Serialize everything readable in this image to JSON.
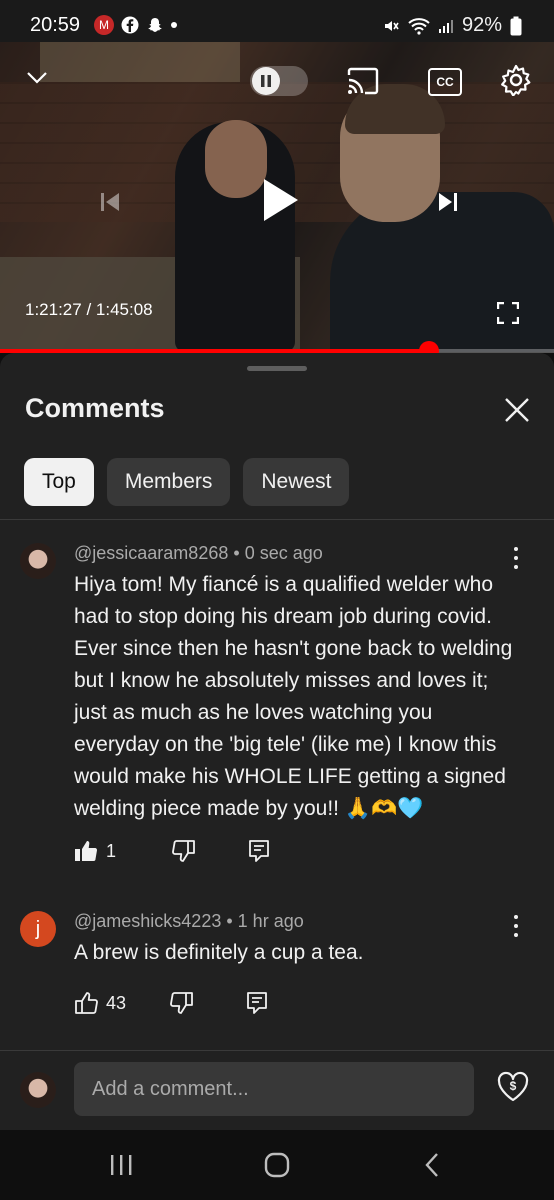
{
  "status_bar": {
    "time": "20:59",
    "m_badge": "M",
    "battery": "92%"
  },
  "video": {
    "timecode": "1:21:27 / 1:45:08",
    "progress": 0.774,
    "cc_label": "CC",
    "icons": [
      "chevron-down-icon",
      "pause-icon",
      "cast-icon",
      "cc-icon",
      "gear-icon",
      "previous-icon",
      "play-icon",
      "next-icon",
      "fullscreen-icon"
    ]
  },
  "panel": {
    "title": "Comments",
    "chips": [
      "Top",
      "Members",
      "Newest"
    ],
    "active_chip": "Top"
  },
  "comments": [
    {
      "author": "@jessicaaram8268",
      "time": "0 sec ago",
      "text": "Hiya tom! My fiancé is a qualified welder who had to stop doing his dream job during covid. Ever since then he hasn't gone back to welding but I know he absolutely misses and loves it; just as much as he loves watching you everyday on the 'big tele' (like me) I know this would make his WHOLE LIFE getting a signed welding piece made by you!! 🙏🫶🩵",
      "likes": "1"
    },
    {
      "author": "@jameshicks4223",
      "time": "1 hr ago",
      "avatar_letter": "j",
      "text": "A brew is definitely a cup a tea.",
      "likes": "43"
    }
  ],
  "composer": {
    "placeholder": "Add a comment..."
  },
  "colors": {
    "progress": "#ff0000",
    "background": "#0f0f0f",
    "panel": "#212121",
    "chip_active": "#f1f1f1",
    "avatar_letter_bg": "#d4481f"
  }
}
